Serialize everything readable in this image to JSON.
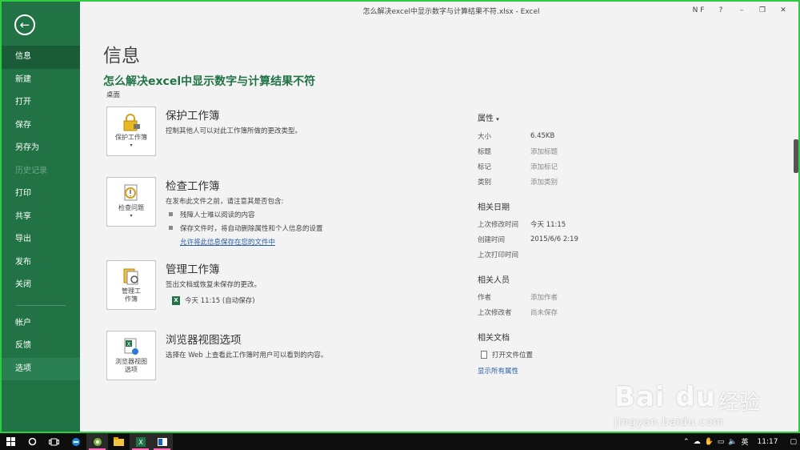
{
  "window": {
    "title": "怎么解决excel中显示数字与计算结果不符.xlsx - Excel",
    "user_initials": "N F",
    "help": "?",
    "minimize": "–",
    "restore": "❐",
    "close": "✕"
  },
  "sidebar": {
    "back_glyph": "←",
    "items": [
      {
        "label": "信息",
        "state": "active"
      },
      {
        "label": "新建"
      },
      {
        "label": "打开"
      },
      {
        "label": "保存"
      },
      {
        "label": "另存为"
      },
      {
        "label": "历史记录",
        "state": "disabled"
      },
      {
        "label": "打印"
      },
      {
        "label": "共享"
      },
      {
        "label": "导出"
      },
      {
        "label": "发布"
      },
      {
        "label": "关闭"
      },
      {
        "label": "帐户"
      },
      {
        "label": "反馈"
      },
      {
        "label": "选项",
        "state": "hover"
      }
    ]
  },
  "main": {
    "page_title": "信息",
    "doc_title": "怎么解决excel中显示数字与计算结果不符",
    "doc_path": "桌面",
    "protect": {
      "button_line1": "保护工作簿",
      "title": "保护工作簿",
      "desc": "控制其他人可以对此工作簿所做的更改类型。",
      "icon": "lock-icon"
    },
    "inspect": {
      "button_line1": "检查问题",
      "title": "检查工作簿",
      "desc": "在发布此文件之前，请注意其是否包含:",
      "bullets": [
        "残障人士难以阅读的内容",
        "保存文件时，将自动删除属性和个人信息的设置"
      ],
      "link": "允许将此信息保存在您的文件中",
      "icon": "inspect-icon"
    },
    "manage": {
      "button_line1": "管理工",
      "button_line2": "作簿",
      "title": "管理工作簿",
      "desc": "签出文档或恢复未保存的更改。",
      "autosave": "今天 11:15 (自动保存)",
      "icon": "manage-icon"
    },
    "browser": {
      "button_line1": "浏览器视图",
      "button_line2": "选项",
      "title": "浏览器视图选项",
      "desc": "选择在 Web 上查看此工作簿时用户可以看到的内容。",
      "icon": "browser-view-icon"
    }
  },
  "properties": {
    "header": "属性",
    "rows": [
      {
        "k": "大小",
        "v": "6.45KB"
      },
      {
        "k": "标题",
        "v": "添加标题",
        "muted": true
      },
      {
        "k": "标记",
        "v": "添加标记",
        "muted": true
      },
      {
        "k": "类别",
        "v": "添加类别",
        "muted": true
      }
    ],
    "dates_header": "相关日期",
    "dates": [
      {
        "k": "上次修改时间",
        "v": "今天 11:15"
      },
      {
        "k": "创建时间",
        "v": "2015/6/6 2:19"
      },
      {
        "k": "上次打印时间",
        "v": ""
      }
    ],
    "people_header": "相关人员",
    "people": [
      {
        "k": "作者",
        "v": "添加作者",
        "muted": true
      },
      {
        "k": "上次修改者",
        "v": "尚未保存",
        "muted": true
      }
    ],
    "docs_header": "相关文档",
    "open_location": "打开文件位置",
    "show_all": "显示所有属性"
  },
  "watermark": {
    "brand": "Bai du",
    "cn": "经验",
    "url": "jingyan.baidu.com"
  },
  "taskbar": {
    "time": "11:17",
    "ime": "英",
    "apps": [
      "start-icon",
      "search-icon",
      "task-view-icon",
      "edge-icon",
      "browser-icon",
      "explorer-icon",
      "excel-icon",
      "outlook-icon"
    ]
  },
  "colors": {
    "excel_green": "#217346",
    "link_blue": "#2a5ea8"
  }
}
